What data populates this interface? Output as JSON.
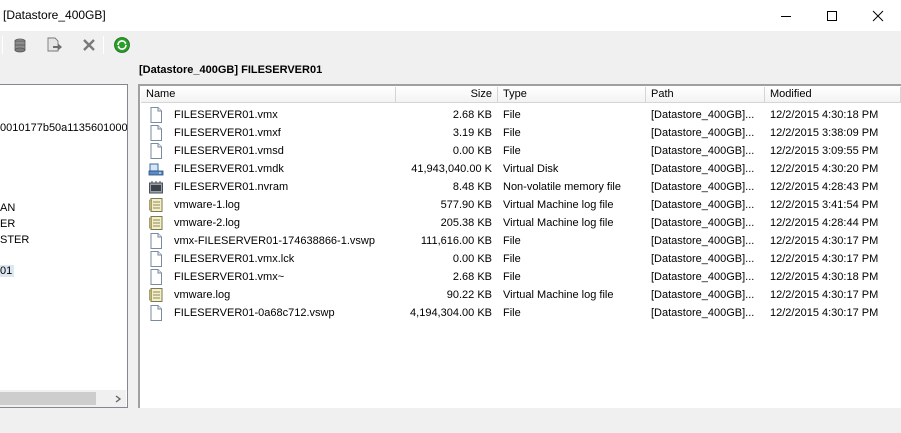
{
  "window": {
    "title": "[Datastore_400GB]"
  },
  "path_header": "[Datastore_400GB] FILESERVER01",
  "tree": {
    "items": [
      {
        "label": "0010177b50a1135601000",
        "selected": false
      },
      {
        "label": "AN",
        "selected": false
      },
      {
        "label": "ER",
        "selected": false
      },
      {
        "label": "STER",
        "selected": false
      },
      {
        "label": "01",
        "selected": true
      }
    ]
  },
  "columns": {
    "name": "Name",
    "size": "Size",
    "type": "Type",
    "path": "Path",
    "modified": "Modified"
  },
  "files": [
    {
      "name": "FILESERVER01.vmx",
      "size": "2.68 KB",
      "type": "File",
      "path": "[Datastore_400GB]...",
      "modified": "12/2/2015 4:30:18 PM",
      "icon": "document-icon"
    },
    {
      "name": "FILESERVER01.vmxf",
      "size": "3.19 KB",
      "type": "File",
      "path": "[Datastore_400GB]...",
      "modified": "12/2/2015 3:38:09 PM",
      "icon": "document-icon"
    },
    {
      "name": "FILESERVER01.vmsd",
      "size": "0.00 KB",
      "type": "File",
      "path": "[Datastore_400GB]...",
      "modified": "12/2/2015 3:09:55 PM",
      "icon": "document-icon"
    },
    {
      "name": "FILESERVER01.vmdk",
      "size": "41,943,040.00 K",
      "type": "Virtual Disk",
      "path": "[Datastore_400GB]...",
      "modified": "12/2/2015 4:30:20 PM",
      "icon": "virtual-disk-icon"
    },
    {
      "name": "FILESERVER01.nvram",
      "size": "8.48 KB",
      "type": "Non-volatile memory file",
      "path": "[Datastore_400GB]...",
      "modified": "12/2/2015 4:28:43 PM",
      "icon": "nvram-icon"
    },
    {
      "name": "vmware-1.log",
      "size": "577.90 KB",
      "type": "Virtual Machine log file",
      "path": "[Datastore_400GB]...",
      "modified": "12/2/2015 3:41:54 PM",
      "icon": "log-file-icon"
    },
    {
      "name": "vmware-2.log",
      "size": "205.38 KB",
      "type": "Virtual Machine log file",
      "path": "[Datastore_400GB]...",
      "modified": "12/2/2015 4:28:44 PM",
      "icon": "log-file-icon"
    },
    {
      "name": "vmx-FILESERVER01-174638866-1.vswp",
      "size": "111,616.00 KB",
      "type": "File",
      "path": "[Datastore_400GB]...",
      "modified": "12/2/2015 4:30:17 PM",
      "icon": "document-icon"
    },
    {
      "name": "FILESERVER01.vmx.lck",
      "size": "0.00 KB",
      "type": "File",
      "path": "[Datastore_400GB]...",
      "modified": "12/2/2015 4:30:17 PM",
      "icon": "document-icon"
    },
    {
      "name": "FILESERVER01.vmx~",
      "size": "2.68 KB",
      "type": "File",
      "path": "[Datastore_400GB]...",
      "modified": "12/2/2015 4:30:18 PM",
      "icon": "document-icon"
    },
    {
      "name": "vmware.log",
      "size": "90.22 KB",
      "type": "Virtual Machine log file",
      "path": "[Datastore_400GB]...",
      "modified": "12/2/2015 4:30:17 PM",
      "icon": "log-file-icon"
    },
    {
      "name": "FILESERVER01-0a68c712.vswp",
      "size": "4,194,304.00 KB",
      "type": "File",
      "path": "[Datastore_400GB]...",
      "modified": "12/2/2015 4:30:17 PM",
      "icon": "document-icon"
    }
  ],
  "toolbar": {
    "icons": [
      "datastore-icon",
      "move-file-icon",
      "delete-icon",
      "refresh-icon"
    ]
  },
  "colors": {
    "refresh_green": "#2a9d2a",
    "selection": "#dde7f3"
  }
}
